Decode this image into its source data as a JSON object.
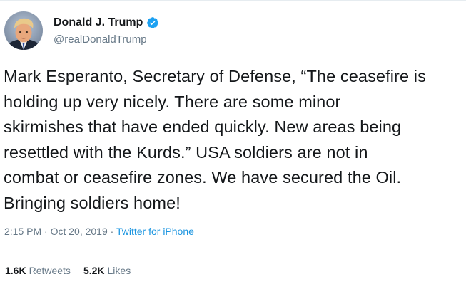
{
  "author": {
    "display_name": "Donald J. Trump",
    "handle": "@realDonaldTrump",
    "verified": true,
    "avatar_icon": "profile-photo"
  },
  "tweet": {
    "lines": [
      "Mark Esperanto, Secretary of Defense, “The ceasefire is",
      "holding up very nicely. There are some minor",
      "skirmishes that have ended quickly. New areas being",
      "resettled with the Kurds.” USA soldiers are not in",
      "combat or ceasefire zones. We have secured the Oil.",
      "Bringing soldiers home!"
    ]
  },
  "meta": {
    "time": "2:15 PM",
    "separator": "·",
    "date": "Oct 20, 2019",
    "separator2": "·",
    "source": "Twitter for iPhone"
  },
  "stats": {
    "retweets_count": "1.6K",
    "retweets_label": "Retweets",
    "likes_count": "5.2K",
    "likes_label": "Likes"
  },
  "colors": {
    "text": "#14171a",
    "secondary": "#657786",
    "link": "#1b95e0",
    "verified": "#1da1f2",
    "divider": "#e6ecf0"
  }
}
